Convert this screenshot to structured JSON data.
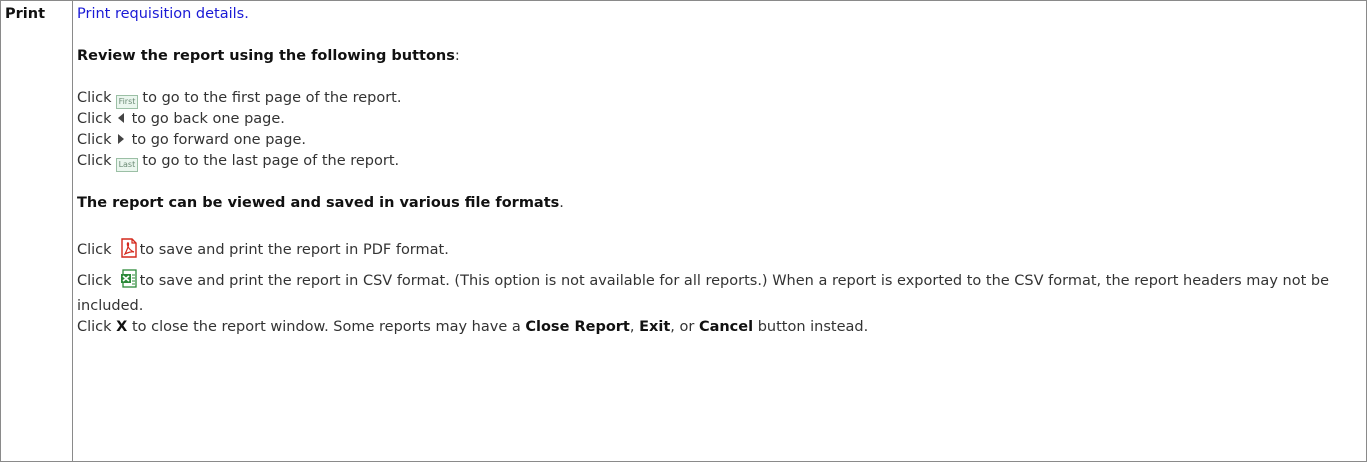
{
  "row": {
    "key": "Print",
    "link_text": "Print requisition details.",
    "review_heading": "Review the report using the following buttons",
    "review_colon": ":",
    "buttons": {
      "first_label": "First",
      "last_label": "Last"
    },
    "click_word": "Click",
    "first_text": "to go to the first page of the report.",
    "prev_text": "to go back one page.",
    "next_text": "to go forward one page.",
    "last_text": "to go to the last page of the report.",
    "formats_heading": "The report can be viewed and saved in various file formats",
    "formats_period": ".",
    "pdf_text": "to save and print the report in PDF format.",
    "csv_text": "to save and print the report in CSV format. (This option is not available for all reports.) When a report is exported to the CSV format, the report headers may not be included.",
    "close_x": "X",
    "close_text_1": "to close the report window. Some reports may have a",
    "close_report": "Close Report",
    "comma": ",",
    "exit": "Exit",
    "or_text": ", or",
    "cancel": "Cancel",
    "close_text_2": "button instead."
  },
  "icons": [
    "first-page-icon",
    "previous-page-icon",
    "next-page-icon",
    "last-page-icon",
    "pdf-icon",
    "csv-icon"
  ],
  "colors": {
    "link": "#1a1ad6",
    "border": "#8a8a8a",
    "pdf_red": "#d4281c",
    "csv_green": "#2d8a3a"
  }
}
